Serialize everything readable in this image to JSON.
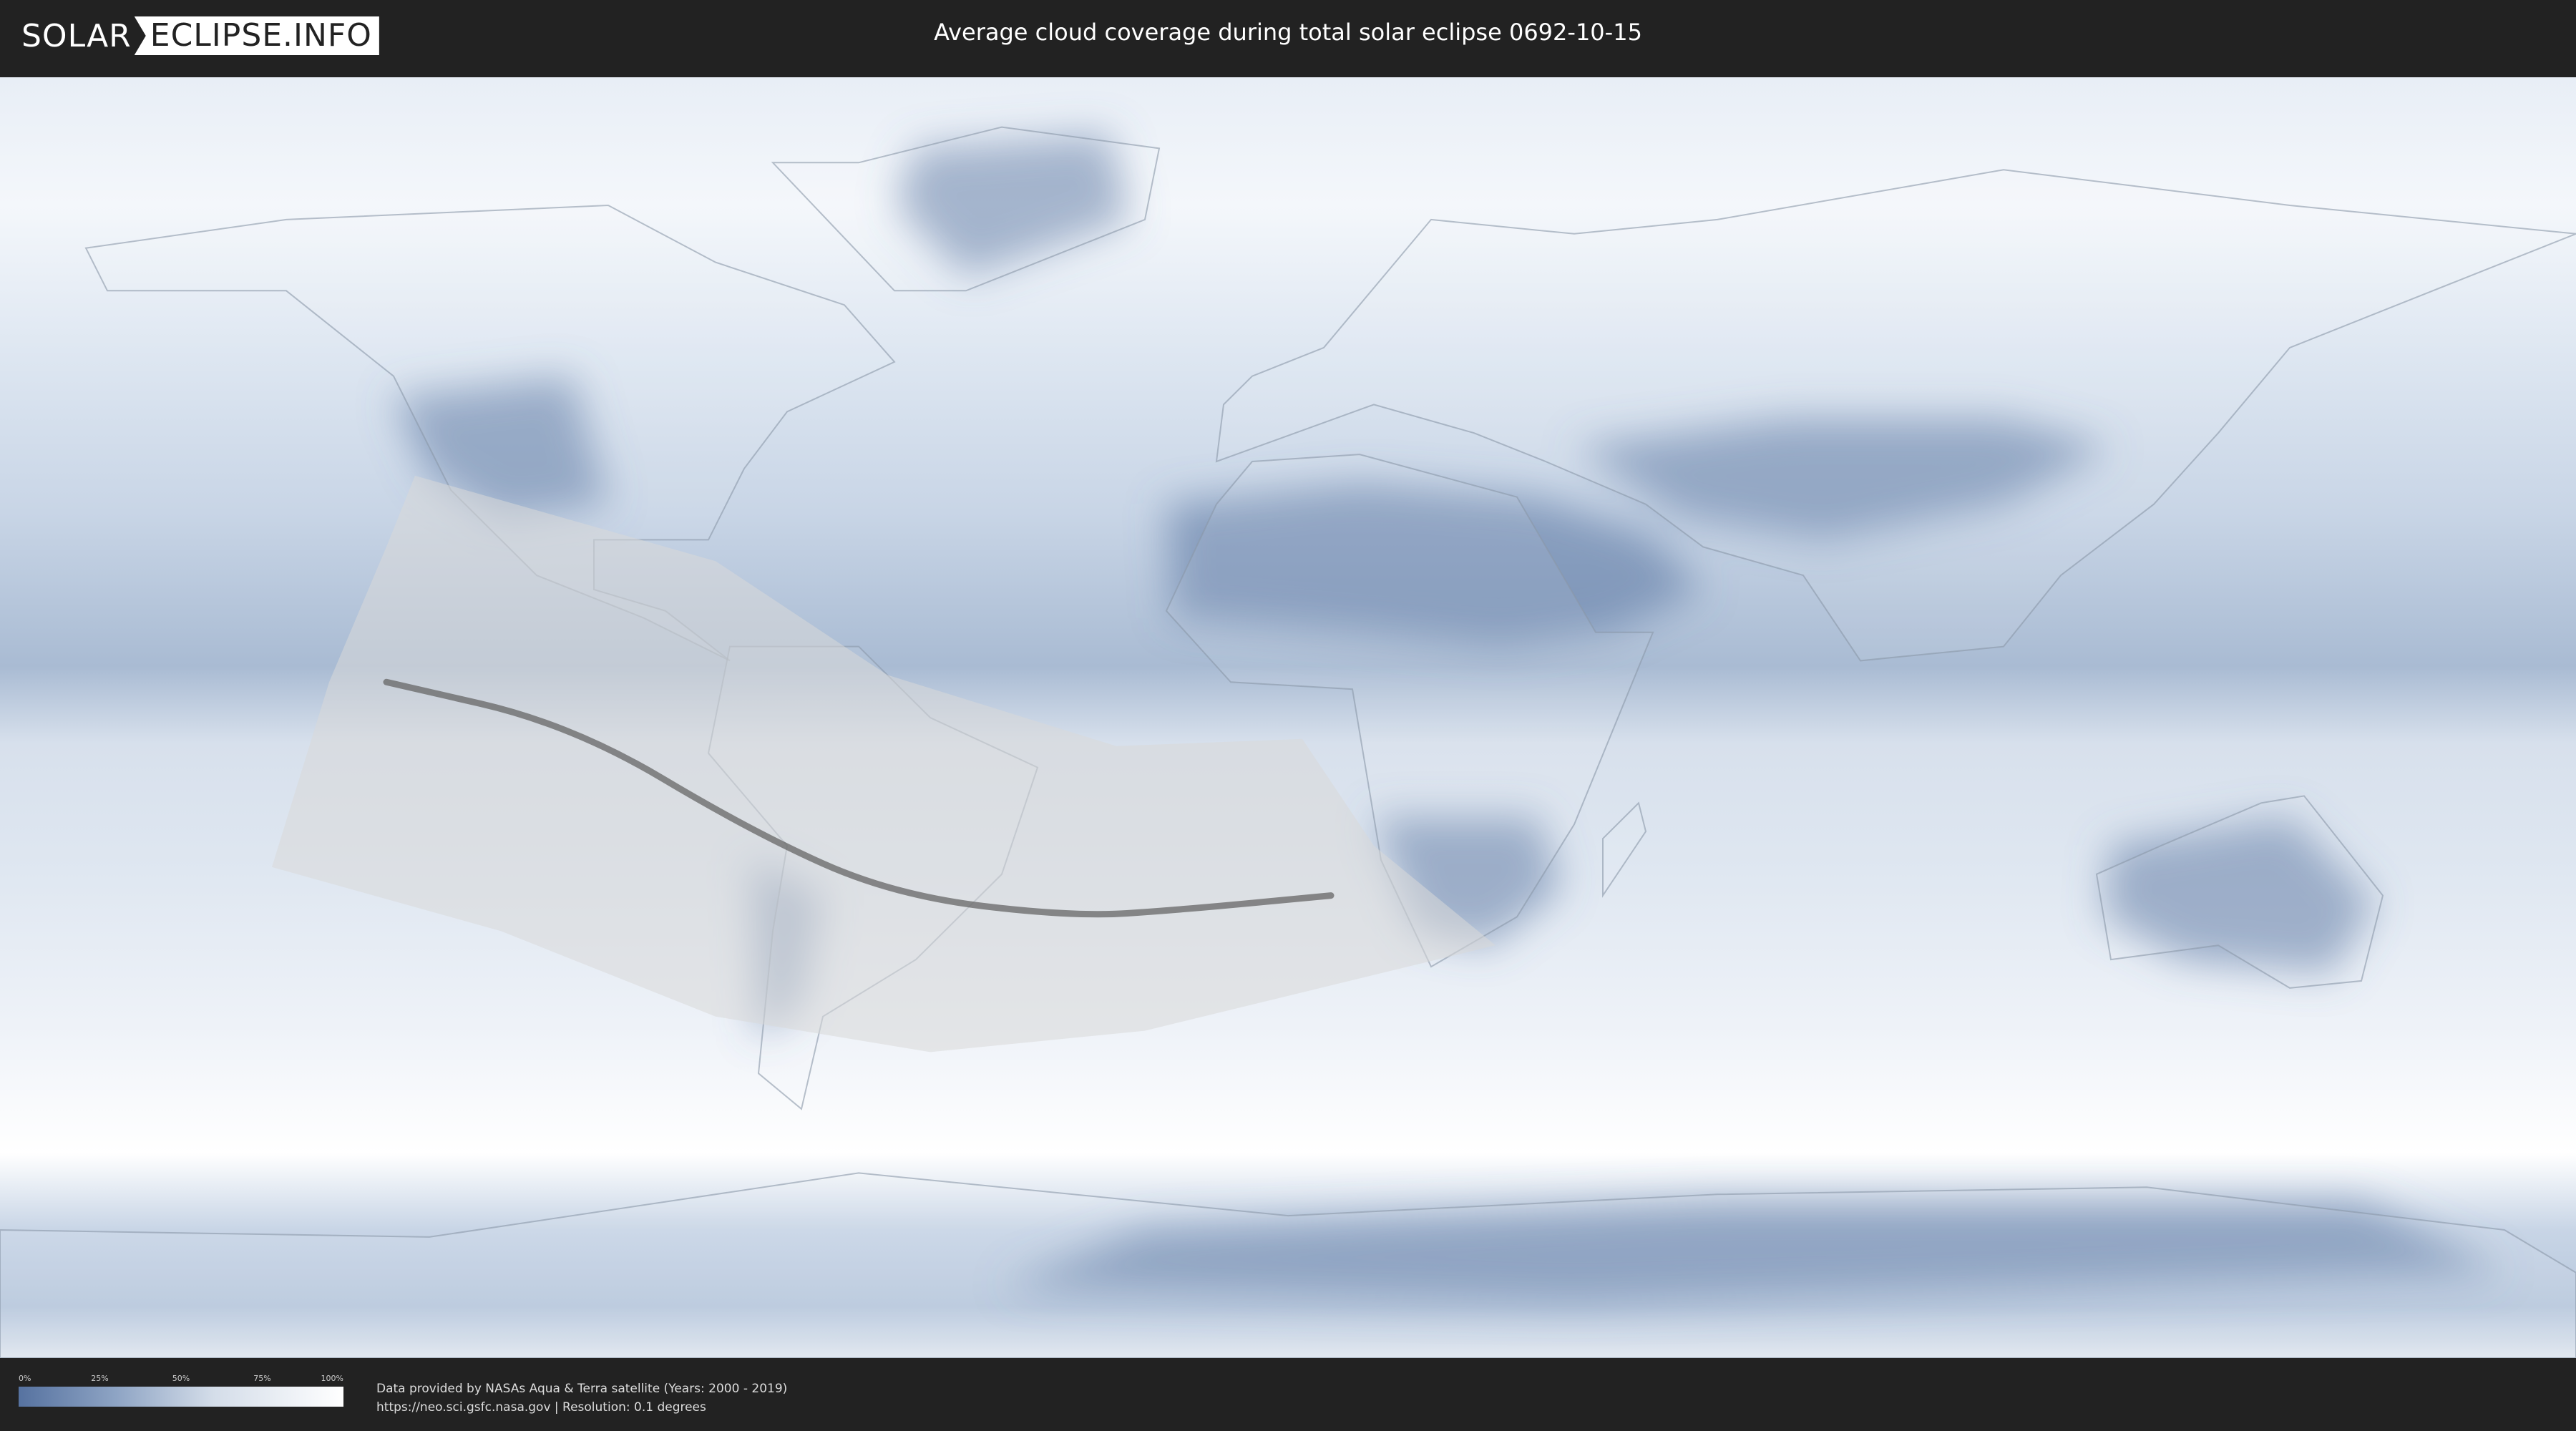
{
  "header": {
    "logo_left": "SOLAR",
    "logo_right": "ECLIPSE.INFO",
    "title": "Average cloud coverage during total solar eclipse 0692-10-15"
  },
  "map": {
    "projection": "equirectangular",
    "longitude_range": [
      -180,
      180
    ],
    "latitude_range": [
      -90,
      90
    ],
    "colors": {
      "clear": "#5672a0",
      "mid": "#a9bbd3",
      "cloudy": "#ffffff",
      "eclipse_overlay": "#d9d9d9",
      "central_line": "#666666"
    },
    "eclipse_region": {
      "north_edge": [
        [
          -122,
          34
        ],
        [
          -80,
          22
        ],
        [
          -56,
          6
        ],
        [
          -24,
          -4
        ],
        [
          2,
          -3
        ]
      ],
      "south_edge": [
        [
          -142,
          -21
        ],
        [
          -110,
          -30
        ],
        [
          -80,
          -42
        ],
        [
          -50,
          -47
        ],
        [
          -20,
          -44
        ],
        [
          29,
          -32
        ]
      ],
      "west_edge": [
        [
          -142,
          -21
        ],
        [
          -134,
          5
        ],
        [
          -126,
          24
        ],
        [
          -122,
          34
        ]
      ],
      "east_edge": [
        [
          2,
          -3
        ],
        [
          12,
          -18
        ],
        [
          29,
          -32
        ]
      ]
    },
    "central_line": [
      [
        -126,
        5
      ],
      [
        -100,
        -1
      ],
      [
        -75,
        -16
      ],
      [
        -55,
        -25
      ],
      [
        -30,
        -28
      ],
      [
        -15,
        -27
      ],
      [
        6,
        -25
      ]
    ]
  },
  "footer": {
    "legend_labels": [
      "0%",
      "25%",
      "50%",
      "75%",
      "100%"
    ],
    "credit_line1": "Data provided by NASAs Aqua & Terra satellite (Years: 2000 - 2019)",
    "credit_line2": "https://neo.sci.gsfc.nasa.gov | Resolution: 0.1 degrees"
  }
}
